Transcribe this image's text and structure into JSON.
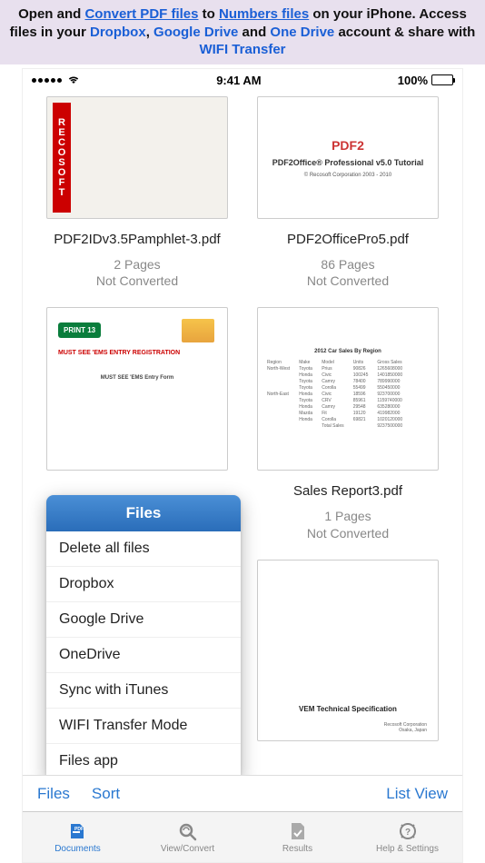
{
  "banner": {
    "t1": "Open and ",
    "l1": "Convert PDF files",
    "t2": " to ",
    "l2": "Numbers files",
    "t3": " on your iPhone. Access files in your ",
    "b1": "Dropbox",
    "t4": ", ",
    "b2": "Google Drive",
    "t5": " and ",
    "b3": "One Drive",
    "t6": " account & share with ",
    "b4": "WIFI Transfer"
  },
  "status": {
    "time": "9:41 AM",
    "battery": "100%"
  },
  "documents": [
    {
      "name": "PDF2IDv3.5Pamphlet-3.pdf",
      "pages": "2 Pages",
      "state": "Not Converted"
    },
    {
      "name": "PDF2OfficePro5.pdf",
      "pages": "86 Pages",
      "state": "Not Converted",
      "thumb": {
        "title": "PDF2Office® Professional v5.0 Tutorial",
        "copy": "© Recosoft Corporation 2003 - 2010",
        "logo": "PDF2"
      }
    },
    {
      "name": "",
      "pages": "",
      "state": "",
      "thumb": {
        "badge": "PRINT 13",
        "red": "MUST SEE 'EMS ENTRY REGISTRATION",
        "mid": "MUST SEE 'EMS Entry Form"
      }
    },
    {
      "name": "Sales Report3.pdf",
      "pages": "1 Pages",
      "state": "Not Converted",
      "thumb": {
        "title": "2012 Car Sales By Region"
      }
    },
    {
      "name": "",
      "pages": "",
      "state": "",
      "thumb": {
        "title": "VEM Technical Specification",
        "foot": "Recosoft Corporation\nOsaka, Japan"
      }
    }
  ],
  "popover": {
    "title": "Files",
    "items": [
      "Delete all files",
      "Dropbox",
      "Google Drive",
      "OneDrive",
      "Sync with iTunes",
      "WIFI Transfer Mode",
      "Files app"
    ]
  },
  "action_bar": {
    "files": "Files",
    "sort": "Sort",
    "listview": "List View"
  },
  "tabs": [
    {
      "label": "Documents"
    },
    {
      "label": "View/Convert"
    },
    {
      "label": "Results"
    },
    {
      "label": "Help & Settings"
    }
  ]
}
